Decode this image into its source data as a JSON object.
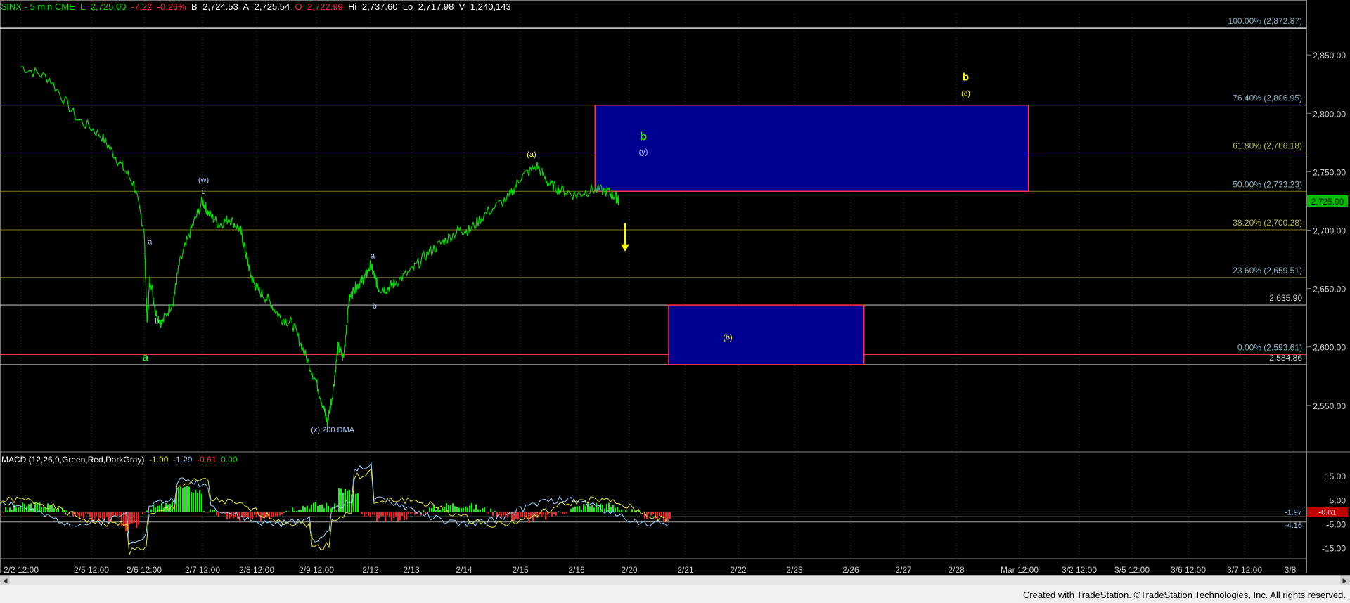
{
  "header": {
    "symbol": "$INX - 5 min  CME",
    "last": "L=2,725.00",
    "change": "-7.22",
    "change_pct": "-0.26%",
    "bid": "B=2,724.53",
    "ask": "A=2,725.54",
    "open": "O=2,722.99",
    "high": "Hi=2,737.60",
    "low": "Lo=2,717.98",
    "volume": "V=1,240,143"
  },
  "macd_header": {
    "label": "MACD (12,26,9,Green,Red,DarkGray)",
    "v1": "-1.90",
    "v2": "-1.29",
    "v3": "-0.61",
    "v4": "0.00"
  },
  "footer": "Created with TradeStation. ©TradeStation Technologies, Inc. All rights reserved.",
  "colors": {
    "price": "#00e000",
    "box": "#000090",
    "box_border": "#ff3050",
    "fib_line": "#7a7a20",
    "level_line": "#b0b0b0",
    "yellow": "#ffff00",
    "label_blue": "#a8c8ff",
    "green_label": "#39d639",
    "macd_green": "#00ff00",
    "macd_red": "#ff2020"
  },
  "chart_data": {
    "type": "line",
    "title": "$INX - 5 min",
    "ylim": [
      2515,
      2885
    ],
    "x_ticks": [
      "2/2 12:00",
      "2/5 12:00",
      "2/6 12:00",
      "2/7 12:00",
      "2/8 12:00",
      "2/9 12:00",
      "2/12",
      "2/13",
      "2/14",
      "2/15",
      "2/16",
      "2/20",
      "2/21",
      "2/22",
      "2/23",
      "2/26",
      "2/27",
      "2/28",
      "Mar 12:00",
      "3/2 12:00",
      "3/5 12:00",
      "3/6 12:00",
      "3/7 12:00",
      "3/8"
    ],
    "y_ticks": [
      "2,850.00",
      "2,800.00",
      "2,750.00",
      "2,700.00",
      "2,650.00",
      "2,600.00",
      "2,550.00"
    ],
    "y_tick_values": [
      2850,
      2800,
      2750,
      2700,
      2650,
      2600,
      2550
    ],
    "price_path_tick": [
      [
        0,
        2840
      ],
      [
        0.4,
        2830
      ],
      [
        0.8,
        2795
      ],
      [
        1.2,
        2780
      ],
      [
        1.5,
        2760
      ],
      [
        1.8,
        2740
      ],
      [
        2.0,
        2700
      ],
      [
        2.05,
        2620
      ],
      [
        2.1,
        2660
      ],
      [
        2.2,
        2630
      ],
      [
        2.3,
        2620
      ],
      [
        2.5,
        2640
      ],
      [
        2.6,
        2670
      ],
      [
        2.8,
        2700
      ],
      [
        3.0,
        2725
      ],
      [
        3.1,
        2715
      ],
      [
        3.3,
        2705
      ],
      [
        3.5,
        2710
      ],
      [
        3.7,
        2700
      ],
      [
        3.8,
        2680
      ],
      [
        3.9,
        2660
      ],
      [
        4.0,
        2650
      ],
      [
        4.2,
        2640
      ],
      [
        4.4,
        2625
      ],
      [
        4.6,
        2620
      ],
      [
        4.8,
        2595
      ],
      [
        5.0,
        2570
      ],
      [
        5.15,
        2545
      ],
      [
        5.2,
        2535
      ],
      [
        5.3,
        2560
      ],
      [
        5.4,
        2600
      ],
      [
        5.5,
        2590
      ],
      [
        5.6,
        2640
      ],
      [
        5.7,
        2650
      ],
      [
        5.8,
        2655
      ],
      [
        5.9,
        2660
      ],
      [
        6.0,
        2670
      ],
      [
        6.1,
        2660
      ],
      [
        6.2,
        2650
      ],
      [
        6.4,
        2650
      ],
      [
        6.6,
        2655
      ],
      [
        7.0,
        2665
      ],
      [
        7.3,
        2680
      ],
      [
        7.6,
        2690
      ],
      [
        7.9,
        2700
      ],
      [
        8.1,
        2700
      ],
      [
        8.4,
        2715
      ],
      [
        8.8,
        2728
      ],
      [
        9.0,
        2745
      ],
      [
        9.3,
        2755
      ],
      [
        9.5,
        2740
      ],
      [
        9.7,
        2735
      ],
      [
        10.0,
        2730
      ],
      [
        10.3,
        2735
      ],
      [
        10.6,
        2733
      ],
      [
        10.75,
        2728
      ],
      [
        10.8,
        2725
      ]
    ],
    "current_price": "2,725.00",
    "fib_levels": [
      {
        "label": "100.00% (2,872.87)",
        "value": 2872.87
      },
      {
        "label": "76.40% (2,806.95)",
        "value": 2806.95
      },
      {
        "label": "61.80% (2,766.18)",
        "value": 2766.18
      },
      {
        "label": "50.00% (2,733.23)",
        "value": 2733.23
      },
      {
        "label": "38.20% (2,700.28)",
        "value": 2700.28
      },
      {
        "label": "23.60% (2,659.51)",
        "value": 2659.51
      },
      {
        "label": "0.00% (2,593.61)",
        "value": 2593.61
      }
    ],
    "levels": [
      {
        "label": "2,635.90",
        "value": 2635.9
      },
      {
        "label": "2,584.86",
        "value": 2584.86
      }
    ],
    "boxes": [
      {
        "name": "upper-target-box",
        "x0": 10.35,
        "x1": 18.15,
        "y0": 2733.23,
        "y1": 2806.95
      },
      {
        "name": "lower-target-box",
        "x0": 11.7,
        "x1": 15.25,
        "y0": 2584.86,
        "y1": 2635.9
      }
    ],
    "annotations": [
      {
        "text": "a",
        "x": 2.1,
        "y": 2688,
        "color": "label_blue",
        "size": 11
      },
      {
        "text": "b",
        "x": 2.22,
        "y": 2620,
        "color": "label_blue",
        "size": 11
      },
      {
        "text": "a",
        "x": 2.02,
        "y": 2588,
        "color": "green_label",
        "size": 16
      },
      {
        "text": "(w)",
        "x": 3.02,
        "y": 2741,
        "color": "label_blue",
        "size": 11
      },
      {
        "text": "c",
        "x": 3.02,
        "y": 2731,
        "color": "label_blue",
        "size": 11
      },
      {
        "text": "a",
        "x": 6.05,
        "y": 2676,
        "color": "label_blue",
        "size": 11
      },
      {
        "text": "b",
        "x": 6.1,
        "y": 2633,
        "color": "label_blue",
        "size": 11
      },
      {
        "text": "(x)  200 DMA",
        "x": 5.3,
        "y": 2527,
        "color": "label_blue",
        "size": 11
      },
      {
        "text": "(a)",
        "x": 9.2,
        "y": 2763,
        "color": "yellow",
        "size": 11
      },
      {
        "text": "b",
        "x": 11.25,
        "y": 2777,
        "color": "green_label",
        "size": 17
      },
      {
        "text": "(y)",
        "x": 11.25,
        "y": 2765,
        "color": "label_blue",
        "size": 11
      },
      {
        "text": "b",
        "x": 17.15,
        "y": 2828,
        "color": "yellow",
        "size": 15
      },
      {
        "text": "(c)",
        "x": 17.15,
        "y": 2815,
        "color": "yellow",
        "size": 11
      },
      {
        "text": "(b)",
        "x": 12.8,
        "y": 2606,
        "color": "yellow",
        "size": 11
      }
    ],
    "arrow": {
      "x": 10.92,
      "y_from": 2706,
      "y_to": 2683,
      "direction": "down"
    },
    "macd": {
      "y_ticks": [
        "15.00",
        "5.00",
        "-5.00",
        "-15.00"
      ],
      "y_tick_values": [
        15,
        5,
        -5,
        -15
      ],
      "ylim": [
        -18,
        20
      ],
      "current": [
        "-1.97",
        "-4.16",
        "-0.61"
      ]
    }
  }
}
